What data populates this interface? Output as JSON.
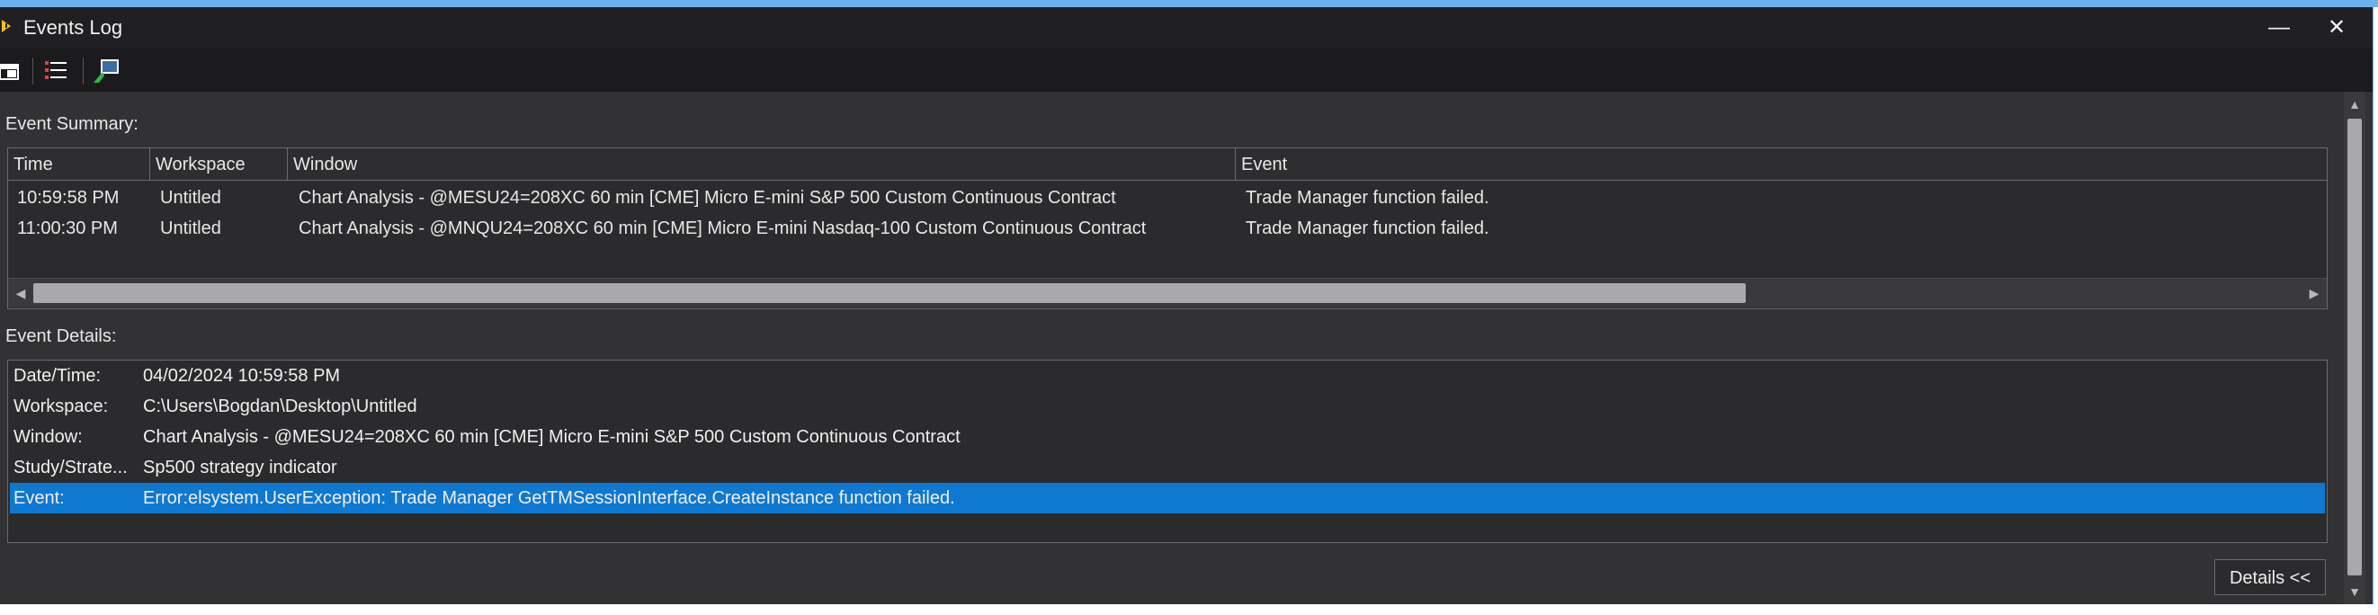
{
  "window": {
    "title": "Events Log",
    "minimize_glyph": "—",
    "close_glyph": "✕"
  },
  "toolbar": {
    "icons": [
      "layout-icon",
      "list-icon",
      "export-icon"
    ]
  },
  "summary": {
    "label": "Event Summary:",
    "columns": [
      "Time",
      "Workspace",
      "Window",
      "Event"
    ],
    "rows": [
      {
        "time": "10:59:58 PM",
        "workspace": "Untitled",
        "window": "Chart Analysis - @MESU24=208XC 60 min [CME] Micro E-mini S&P 500 Custom Continuous Contract",
        "event": "Trade Manager function failed."
      },
      {
        "time": "11:00:30 PM",
        "workspace": "Untitled",
        "window": "Chart Analysis - @MNQU24=208XC 60 min [CME] Micro E-mini Nasdaq-100 Custom Continuous Contract",
        "event": "Trade Manager function failed."
      }
    ]
  },
  "details": {
    "label": "Event Details:",
    "rows": [
      {
        "label": "Date/Time:",
        "value": "04/02/2024 10:59:58 PM"
      },
      {
        "label": "Workspace:",
        "value": "C:\\Users\\Bogdan\\Desktop\\Untitled"
      },
      {
        "label": "Window:",
        "value": "Chart Analysis - @MESU24=208XC 60 min [CME] Micro E-mini S&P 500 Custom Continuous Contract"
      },
      {
        "label": "Study/Strate...",
        "value": "Sp500 strategy indicator"
      },
      {
        "label": "Event:",
        "value": "Error:elsystem.UserException: Trade Manager GetTMSessionInterface.CreateInstance function failed."
      }
    ],
    "selected_index": 4,
    "button_label": "Details <<"
  },
  "colors": {
    "background": "#323235",
    "titlebar": "#202023",
    "selection": "#0f78d1",
    "accent": "#6fb1ea",
    "warning_icon": "#f3c31a"
  }
}
